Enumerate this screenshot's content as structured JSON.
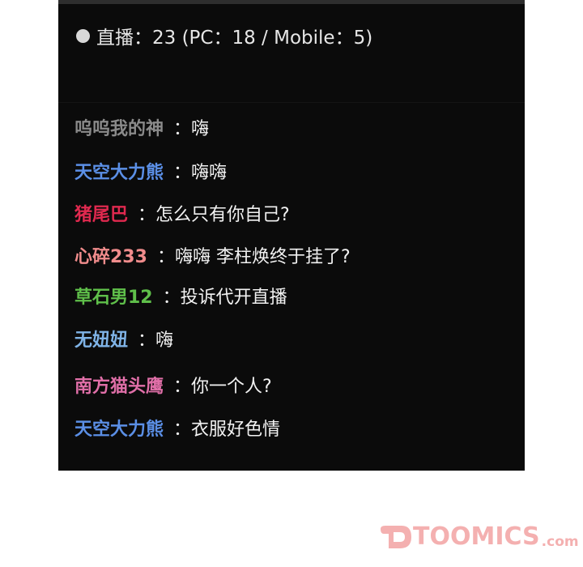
{
  "status": {
    "label": "直播：23 (PC：18 / Mobile：5)"
  },
  "chat": [
    {
      "user": "呜呜我的神",
      "sep": "：",
      "message": "嗨",
      "color": "#8a8a8a"
    },
    {
      "user": "天空大力熊",
      "sep": "：",
      "message": "嗨嗨",
      "color": "#5b8fe6"
    },
    {
      "user": "猪尾巴",
      "sep": "：",
      "message": "怎么只有你自己?",
      "color": "#e0294f"
    },
    {
      "user": "心碎233",
      "sep": "：",
      "message": "嗨嗨 李柱焕终于挂了?",
      "color": "#f08c8c"
    },
    {
      "user": "草石男12",
      "sep": "：",
      "message": "投诉代开直播",
      "color": "#5fbf4a"
    },
    {
      "user": "无妞妞",
      "sep": "：",
      "message": "嗨",
      "color": "#7fb3e6"
    },
    {
      "user": "南方猫头鹰",
      "sep": "：",
      "message": "你一个人?",
      "color": "#e06fa8"
    },
    {
      "user": "天空大力熊",
      "sep": "：",
      "message": "衣服好色情",
      "color": "#5b8fe6"
    }
  ],
  "watermark": {
    "brand": "TOOMICS",
    "domain": ".com",
    "color": "#f4b0b0"
  }
}
